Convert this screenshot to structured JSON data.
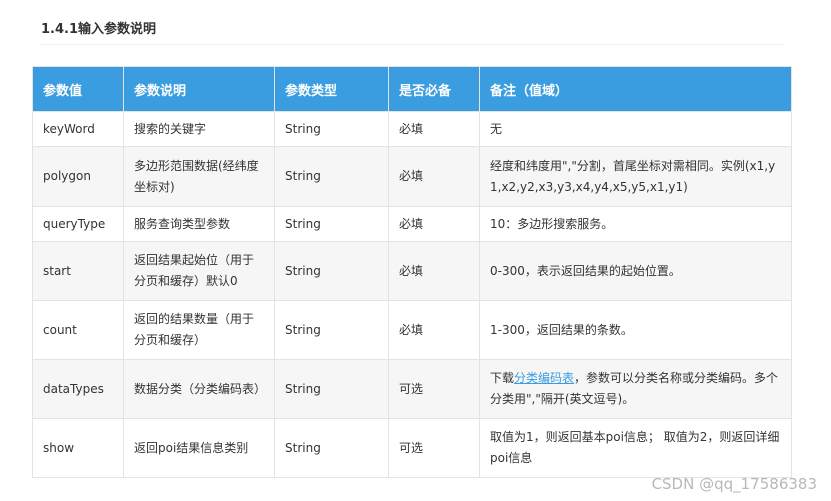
{
  "section_title": "1.4.1输入参数说明",
  "table": {
    "headers": [
      "参数值",
      "参数说明",
      "参数类型",
      "是否必备",
      "备注（值域）"
    ],
    "rows": [
      {
        "param": "keyWord",
        "desc": "搜索的关键字",
        "type": "String",
        "required": "必填",
        "note": "无"
      },
      {
        "param": "polygon",
        "desc": "多边形范围数据(经纬度坐标对)",
        "type": "String",
        "required": "必填",
        "note": "经度和纬度用\",\"分割，首尾坐标对需相同。实例(x1,y1,x2,y2,x3,y3,x4,y4,x5,y5,x1,y1)"
      },
      {
        "param": "queryType",
        "desc": "服务查询类型参数",
        "type": "String",
        "required": "必填",
        "note": "10：多边形搜索服务。"
      },
      {
        "param": "start",
        "desc": "返回结果起始位（用于分页和缓存）默认0",
        "type": "String",
        "required": "必填",
        "note": "0-300，表示返回结果的起始位置。"
      },
      {
        "param": "count",
        "desc": "返回的结果数量（用于分页和缓存）",
        "type": "String",
        "required": "必填",
        "note": "1-300，返回结果的条数。"
      },
      {
        "param": "dataTypes",
        "desc": "数据分类（分类编码表）",
        "type": "String",
        "required": "可选",
        "note_before": "下载",
        "note_link": "分类编码表",
        "note_after": "，参数可以分类名称或分类编码。多个分类用\",\"隔开(英文逗号)。"
      },
      {
        "param": "show",
        "desc": "返回poi结果信息类别",
        "type": "String",
        "required": "可选",
        "note": "取值为1，则返回基本poi信息； 取值为2，则返回详细poi信息"
      }
    ]
  },
  "watermark": "CSDN @qq_17586383",
  "colors": {
    "header_bg": "#3a9de0",
    "link": "#3a9de0",
    "stripe": "#f6f6f6"
  }
}
